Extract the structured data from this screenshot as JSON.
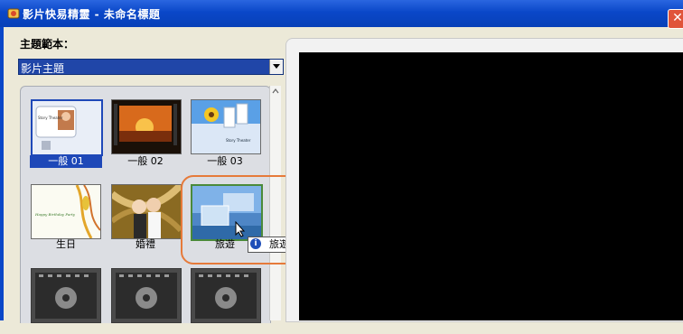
{
  "window": {
    "title": "影片快易精靈 - 未命名標題",
    "close_glyph": "✕"
  },
  "theme_panel": {
    "label": "主題範本：",
    "selected_category": "影片主題"
  },
  "templates": [
    {
      "label": "一般 01",
      "selected": true
    },
    {
      "label": "一般 02",
      "selected": false
    },
    {
      "label": "一般 03",
      "selected": false
    },
    {
      "label": "生日",
      "selected": false
    },
    {
      "label": "婚禮",
      "selected": false
    },
    {
      "label": "旅遊",
      "selected": false
    },
    {
      "label": "",
      "selected": false
    },
    {
      "label": "",
      "selected": false
    },
    {
      "label": "",
      "selected": false
    }
  ],
  "thumb_text": {
    "general01": "Story Theater",
    "general03": "Story Theater",
    "birthday": "Happy Birthday Party"
  },
  "tooltip": {
    "icon": "i",
    "text": "旅遊"
  },
  "colors": {
    "titlebar": "#0a47c8",
    "selection": "#1e48b8",
    "highlight": "#e67a3a",
    "preview_background": "#000000"
  }
}
